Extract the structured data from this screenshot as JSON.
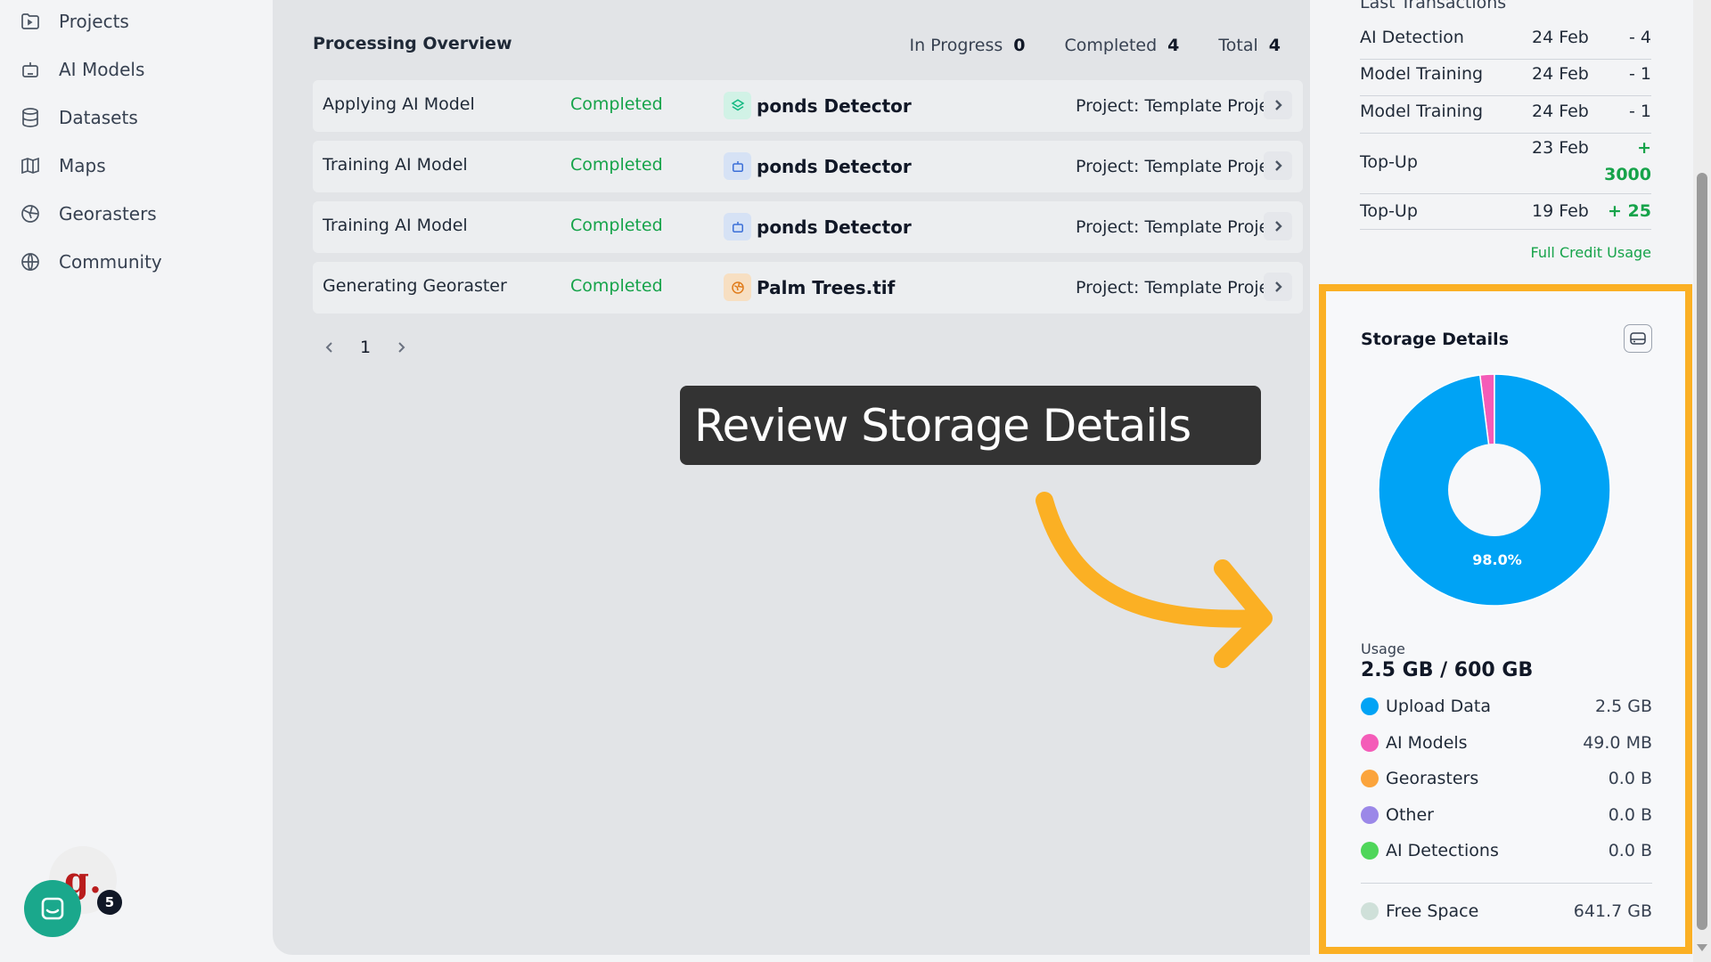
{
  "sidebar": {
    "items": [
      {
        "label": "Projects",
        "icon": "projects-icon"
      },
      {
        "label": "AI Models",
        "icon": "robot-icon"
      },
      {
        "label": "Datasets",
        "icon": "database-icon"
      },
      {
        "label": "Maps",
        "icon": "map-icon"
      },
      {
        "label": "Georasters",
        "icon": "globe-grid-icon"
      },
      {
        "label": "Community",
        "icon": "globe-icon"
      }
    ]
  },
  "processing": {
    "title": "Processing Overview",
    "stats": [
      {
        "label": "In Progress",
        "value": "0"
      },
      {
        "label": "Completed",
        "value": "4"
      },
      {
        "label": "Total",
        "value": "4"
      }
    ],
    "rows": [
      {
        "task": "Applying AI Model",
        "status": "Completed",
        "item": "ponds Detector",
        "project": "Project: Template Project",
        "icon": "layers-icon",
        "icon_color": "#10b981",
        "icon_bg": "#d1f2e6"
      },
      {
        "task": "Training AI Model",
        "status": "Completed",
        "item": "ponds Detector",
        "project": "Project: Template Project",
        "icon": "robot-icon",
        "icon_color": "#3b6fd8",
        "icon_bg": "#d6e2f5"
      },
      {
        "task": "Training AI Model",
        "status": "Completed",
        "item": "ponds Detector",
        "project": "Project: Template Project",
        "icon": "robot-icon",
        "icon_color": "#3b6fd8",
        "icon_bg": "#d6e2f5"
      },
      {
        "task": "Generating Georaster",
        "status": "Completed",
        "item": "Palm Trees.tif",
        "project": "Project: Template Project",
        "icon": "globe-icon",
        "icon_color": "#e07b1a",
        "icon_bg": "#f7dfc2"
      }
    ],
    "page": "1"
  },
  "tooltip": {
    "text": "Review Storage Details"
  },
  "transactions": {
    "heading": "Last Transactions",
    "rows": [
      {
        "name": "AI Detection",
        "date": "24 Feb",
        "amount": "- 4",
        "positive": false
      },
      {
        "name": "Model Training",
        "date": "24 Feb",
        "amount": "- 1",
        "positive": false
      },
      {
        "name": "Model Training",
        "date": "24 Feb",
        "amount": "- 1",
        "positive": false
      },
      {
        "name": "Top-Up",
        "date": "23 Feb",
        "amount_line1": "+",
        "amount_line2": "3000",
        "positive": true
      },
      {
        "name": "Top-Up",
        "date": "19 Feb",
        "amount": "+ 25",
        "positive": true
      }
    ],
    "full_credit_link": "Full Credit Usage"
  },
  "storage": {
    "title": "Storage Details",
    "chart_label": "98.0%",
    "usage_label": "Usage",
    "usage_value": "2.5 GB / 600 GB",
    "legend": [
      {
        "label": "Upload Data",
        "value": "2.5 GB",
        "color": "#00a3f5"
      },
      {
        "label": "AI Models",
        "value": "49.0 MB",
        "color": "#f45cb8"
      },
      {
        "label": "Georasters",
        "value": "0.0 B",
        "color": "#fba43c"
      },
      {
        "label": "Other",
        "value": "0.0 B",
        "color": "#9b88e8"
      },
      {
        "label": "AI Detections",
        "value": "0.0 B",
        "color": "#4fd65a"
      }
    ],
    "free_space": {
      "label": "Free Space",
      "value": "641.7 GB",
      "color": "#cfe0d9"
    }
  },
  "chart_data": {
    "type": "pie",
    "categories": [
      "Upload Data",
      "AI Models"
    ],
    "values": [
      98.0,
      2.0
    ],
    "colors": [
      "#00a3f5",
      "#f45cb8"
    ],
    "annotation": "98.0%"
  },
  "widgets": {
    "avatar_letter": "g.",
    "chat_badge": "5"
  },
  "colors": {
    "accent_green": "#16a34a",
    "highlight_orange": "#fbb024"
  }
}
